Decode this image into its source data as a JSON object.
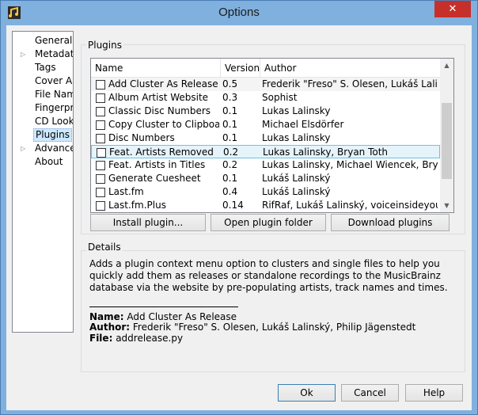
{
  "window": {
    "title": "Options",
    "close_symbol": "✕"
  },
  "nav": {
    "items": [
      {
        "label": "General",
        "expandable": false,
        "selected": false
      },
      {
        "label": "Metadata",
        "expandable": true,
        "selected": false
      },
      {
        "label": "Tags",
        "expandable": false,
        "selected": false
      },
      {
        "label": "Cover Art",
        "expandable": false,
        "selected": false
      },
      {
        "label": "File Naming",
        "expandable": false,
        "selected": false
      },
      {
        "label": "Fingerprinting",
        "expandable": false,
        "selected": false
      },
      {
        "label": "CD Lookup",
        "expandable": false,
        "selected": false
      },
      {
        "label": "Plugins",
        "expandable": false,
        "selected": true
      },
      {
        "label": "Advanced",
        "expandable": true,
        "selected": false
      },
      {
        "label": "About",
        "expandable": false,
        "selected": false
      }
    ]
  },
  "plugins": {
    "group_title": "Plugins",
    "columns": {
      "name": "Name",
      "version": "Version",
      "author": "Author"
    },
    "rows": [
      {
        "name": "Add Cluster As Release",
        "version": "0.5",
        "author": "Frederik \"Freso\" S. Olesen, Lukáš Lalinsk…"
      },
      {
        "name": "Album Artist Website",
        "version": "0.3",
        "author": "Sophist"
      },
      {
        "name": "Classic Disc Numbers",
        "version": "0.1",
        "author": "Lukas Lalinsky"
      },
      {
        "name": "Copy Cluster to Clipboard",
        "version": "0.1",
        "author": "Michael Elsdörfer"
      },
      {
        "name": "Disc Numbers",
        "version": "0.1",
        "author": "Lukas Lalinsky"
      },
      {
        "name": "Feat. Artists Removed",
        "version": "0.2",
        "author": "Lukas Lalinsky, Bryan Toth"
      },
      {
        "name": "Feat. Artists in Titles",
        "version": "0.2",
        "author": "Lukas Lalinsky, Michael Wiencek, Bryan…"
      },
      {
        "name": "Generate Cuesheet",
        "version": "0.1",
        "author": "Lukáš Lalinský"
      },
      {
        "name": "Last.fm",
        "version": "0.4",
        "author": "Lukáš Lalinský"
      },
      {
        "name": "Last.fm.Plus",
        "version": "0.14",
        "author": "RifRaf, Lukáš Lalinský, voiceinsideyou"
      }
    ],
    "buttons": {
      "install": "Install plugin...",
      "open_folder": "Open plugin folder",
      "download": "Download plugins"
    }
  },
  "details": {
    "group_title": "Details",
    "description": "Adds a plugin context menu option to clusters and single files to help you quickly add them as releases or standalone recordings to the MusicBrainz database via the website by pre-populating artists, track names and times.",
    "name_label": "Name:",
    "name_value": " Add Cluster As Release",
    "author_label": "Author:",
    "author_value": " Frederik \"Freso\" S. Olesen, Lukáš Lalinský, Philip Jägenstedt",
    "file_label": "File:",
    "file_value": " addrelease.py"
  },
  "footer": {
    "ok": "Ok",
    "cancel": "Cancel",
    "help": "Help"
  }
}
